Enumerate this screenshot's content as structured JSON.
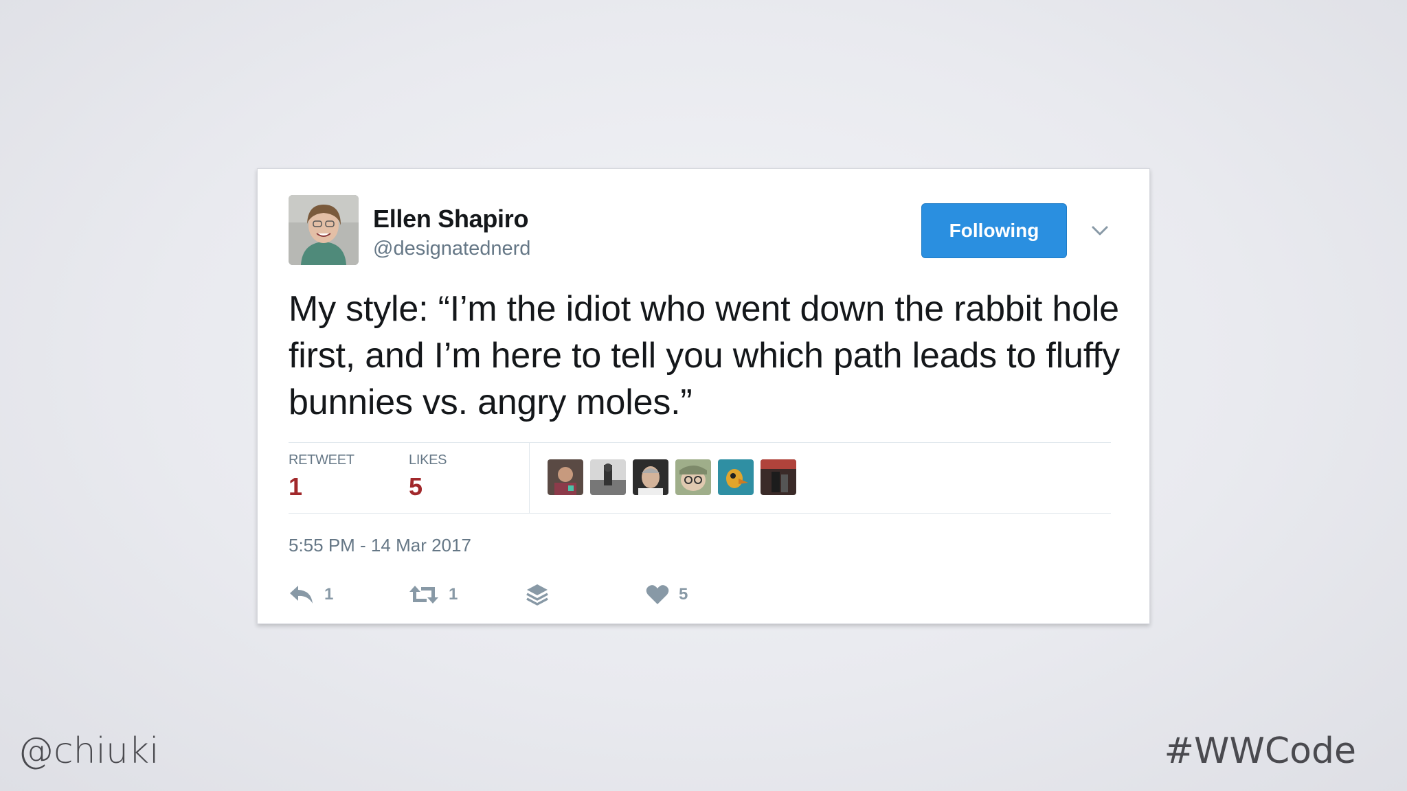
{
  "tweet": {
    "display_name": "Ellen Shapiro",
    "handle": "@designatednerd",
    "follow_button_label": "Following",
    "text": "My style: “I’m the idiot who went down the rabbit hole first, and I’m here to tell you which path leads to fluffy bunnies vs. angry moles.”",
    "stats": {
      "retweet_label": "RETWEET",
      "retweet_count": "1",
      "likes_label": "LIKES",
      "likes_count": "5",
      "liker_avatar_count": 6
    },
    "timestamp": "5:55 PM - 14 Mar 2017",
    "actions": {
      "reply_count": "1",
      "retweet_count": "1",
      "like_count": "5"
    },
    "icons": [
      "caret-down-icon",
      "reply-icon",
      "retweet-icon",
      "stack-icon",
      "heart-icon"
    ]
  },
  "slide": {
    "footer_left": "@chiuki",
    "footer_right": "#WWCode"
  },
  "colors": {
    "follow_button": "#2a8fe0",
    "stat_value": "#a1282b",
    "secondary_text": "#657786",
    "action_icon": "#8899a6"
  }
}
